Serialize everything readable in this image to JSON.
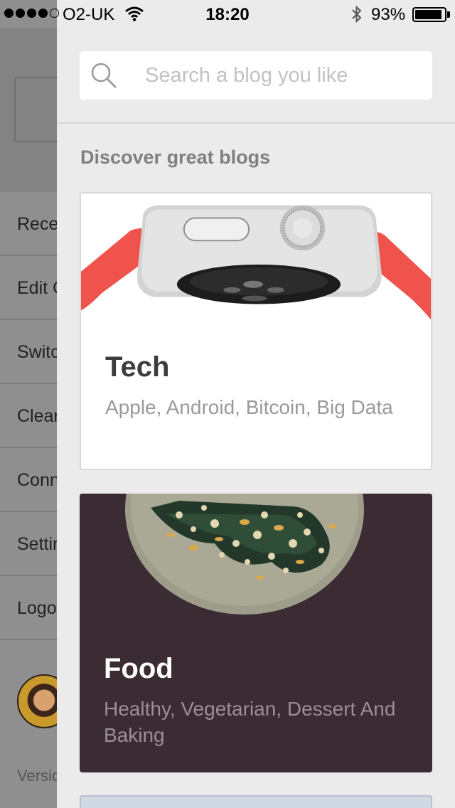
{
  "status_bar": {
    "carrier": "O2-UK",
    "time": "18:20",
    "battery_percent": "93%",
    "battery_level": 0.93,
    "icons": [
      "signal-dots-icon",
      "wifi-icon",
      "bluetooth-icon",
      "battery-icon"
    ]
  },
  "side_menu": {
    "items": [
      {
        "label": "Recent"
      },
      {
        "label": "Edit Categories"
      },
      {
        "label": "Switch"
      },
      {
        "label": "Clear"
      },
      {
        "label": "Connect"
      },
      {
        "label": "Settings"
      },
      {
        "label": "Logout"
      }
    ],
    "version_text": "Version"
  },
  "discover": {
    "search": {
      "placeholder": "Search a blog you like",
      "icon": "search-icon"
    },
    "section_title": "Discover great blogs",
    "cards": [
      {
        "title": "Tech",
        "subtitle": "Apple, Android, Bitcoin, Big Data",
        "image": "smartwatch-image"
      },
      {
        "title": "Food",
        "subtitle": "Healthy, Vegetarian, Dessert And Baking",
        "image": "food-plate-image"
      }
    ]
  },
  "colors": {
    "panel_bg": "#ebebeb",
    "tech_card_bg": "#ffffff",
    "food_card_bg": "#3b2b33",
    "watch_band": "#f0524c"
  }
}
